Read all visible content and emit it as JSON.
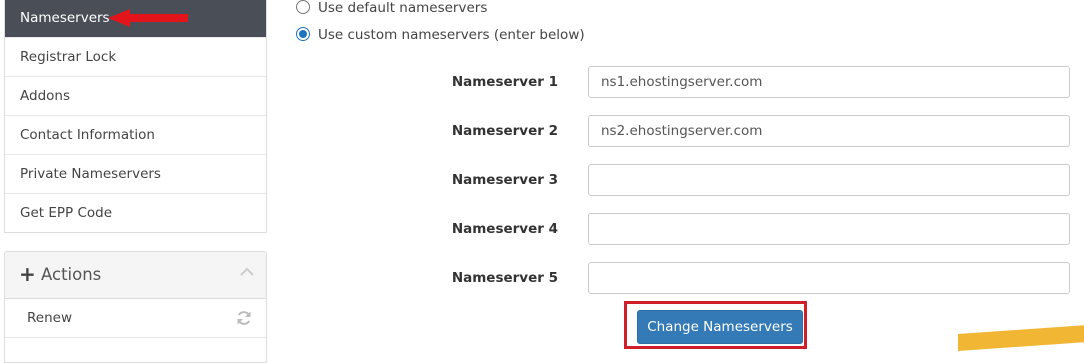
{
  "sidebar": {
    "items": [
      {
        "label": "Nameservers",
        "active": true
      },
      {
        "label": "Registrar Lock"
      },
      {
        "label": "Addons"
      },
      {
        "label": "Contact Information"
      },
      {
        "label": "Private Nameservers"
      },
      {
        "label": "Get EPP Code"
      }
    ]
  },
  "actions": {
    "title": "Actions",
    "items": [
      {
        "label": "Renew",
        "icon": "refresh-icon"
      }
    ]
  },
  "nameserver_options": [
    {
      "label": "Use default nameservers",
      "checked": false
    },
    {
      "label": "Use custom nameservers (enter below)",
      "checked": true
    }
  ],
  "nameservers": [
    {
      "label": "Nameserver 1",
      "value": "ns1.ehostingserver.com"
    },
    {
      "label": "Nameserver 2",
      "value": "ns2.ehostingserver.com"
    },
    {
      "label": "Nameserver 3",
      "value": ""
    },
    {
      "label": "Nameserver 4",
      "value": ""
    },
    {
      "label": "Nameserver 5",
      "value": ""
    }
  ],
  "submit_label": "Change Nameservers",
  "colors": {
    "active_item_bg": "#4a4f57",
    "primary_button": "#337ab7",
    "annotation_red": "#d11f2a",
    "radio_blue": "#1e73be"
  }
}
